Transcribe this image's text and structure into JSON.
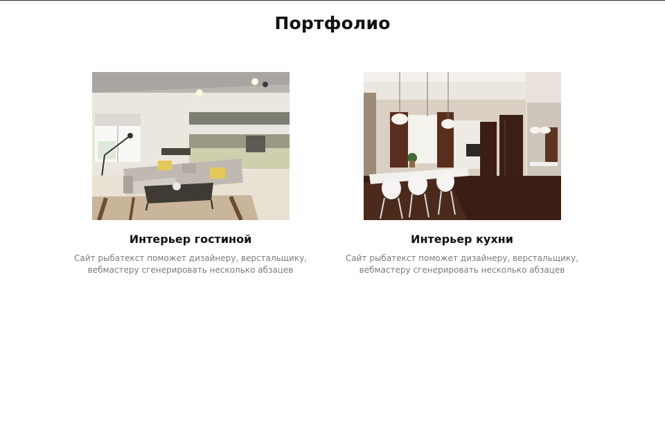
{
  "page": {
    "title": "Портфолио"
  },
  "portfolio": {
    "items": [
      {
        "title": "Интерьер гостиной",
        "description": "Сайт рыбатекст поможет дизайнеру, верстальщику, вебмастеру сгенерировать несколько абзацев",
        "image": "living-room-interior-photo"
      },
      {
        "title": "Интерьер кухни",
        "description": "Сайт рыбатекст поможет дизайнеру, верстальщику, вебмастеру сгенерировать несколько абзацев",
        "image": "kitchen-dining-interior-photo"
      }
    ]
  },
  "colors": {
    "heading": "#111111",
    "text_muted": "#7a7a7a",
    "background": "#ffffff"
  }
}
